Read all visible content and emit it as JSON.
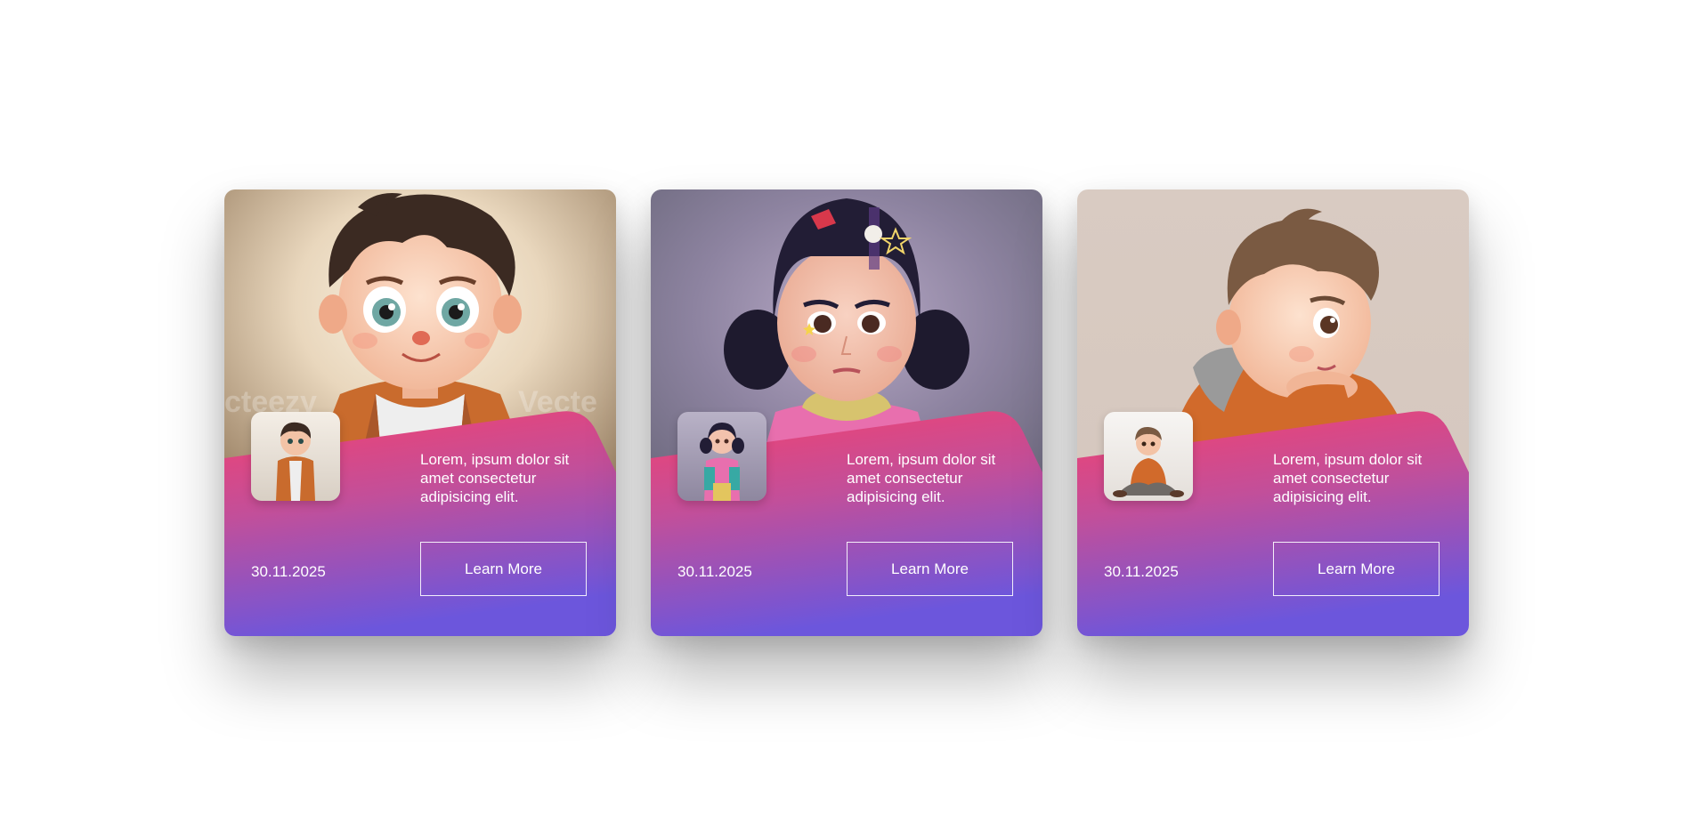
{
  "cards": [
    {
      "description": "Lorem, ipsum dolor sit amet consectetur adipisicing elit.",
      "date": "30.11.2025",
      "button_label": "Learn More",
      "watermark": "vecteezy"
    },
    {
      "description": "Lorem, ipsum dolor sit amet consectetur adipisicing elit.",
      "date": "30.11.2025",
      "button_label": "Learn More"
    },
    {
      "description": "Lorem, ipsum dolor sit amet consectetur adipisicing elit.",
      "date": "30.11.2025",
      "button_label": "Learn More"
    }
  ],
  "colors": {
    "gradient_top": "#f3416f",
    "gradient_bottom": "#6c56dc",
    "text": "#ffffff"
  },
  "icons": {
    "card1": "boy-in-orange-jacket-illustration",
    "card2": "girl-with-hairclips-illustration",
    "card3": "boy-in-hoodie-illustration"
  }
}
